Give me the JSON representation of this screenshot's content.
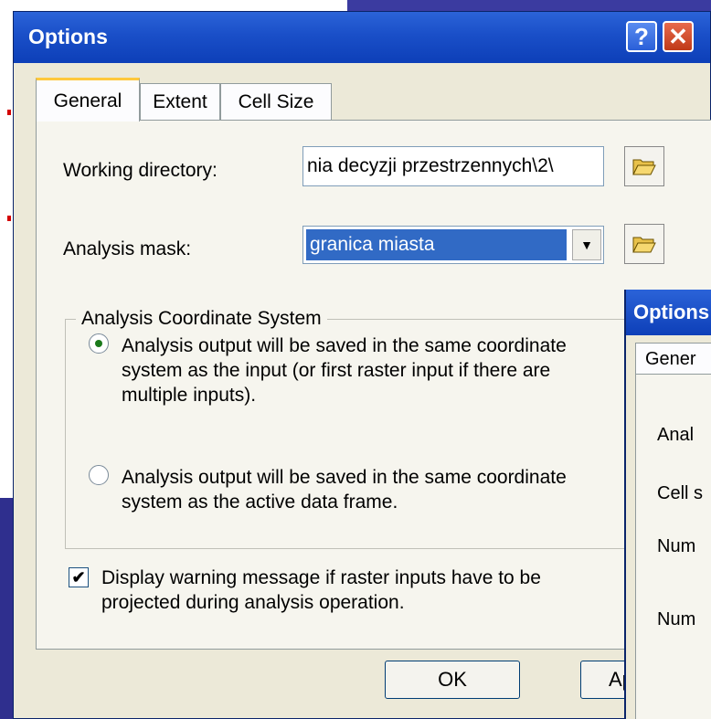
{
  "dialog": {
    "title": "Options",
    "help_label": "?",
    "close_label": "✕"
  },
  "tabs": [
    {
      "label": "General",
      "active": true
    },
    {
      "label": "Extent",
      "active": false
    },
    {
      "label": "Cell Size",
      "active": false
    }
  ],
  "general": {
    "working_directory_label": "Working directory:",
    "working_directory_value": "nia decyzji przestrzennych\\2\\",
    "analysis_mask_label": "Analysis mask:",
    "analysis_mask_value": "granica miasta",
    "coord_group_title": "Analysis Coordinate System",
    "radio_same_as_input": {
      "line1": "Analysis output will be saved in the same coordinate",
      "line2": "system as the input (or first raster input if there are",
      "line3": "multiple inputs).",
      "selected": true
    },
    "radio_active_frame": {
      "line1": "Analysis output will be saved in the same coordinate",
      "line2": "system as the active data frame.",
      "selected": false
    },
    "warning_checkbox": {
      "line1": "Display warning message if raster inputs have to be",
      "line2": "projected during analysis operation.",
      "checked": true
    }
  },
  "buttons": {
    "ok_label": "OK",
    "apply_label_partial": "Ap"
  },
  "second_dialog": {
    "title": "Options",
    "tab_label": "Gener",
    "rows": [
      "Anal",
      "Cell s",
      "Num",
      "Num"
    ]
  }
}
